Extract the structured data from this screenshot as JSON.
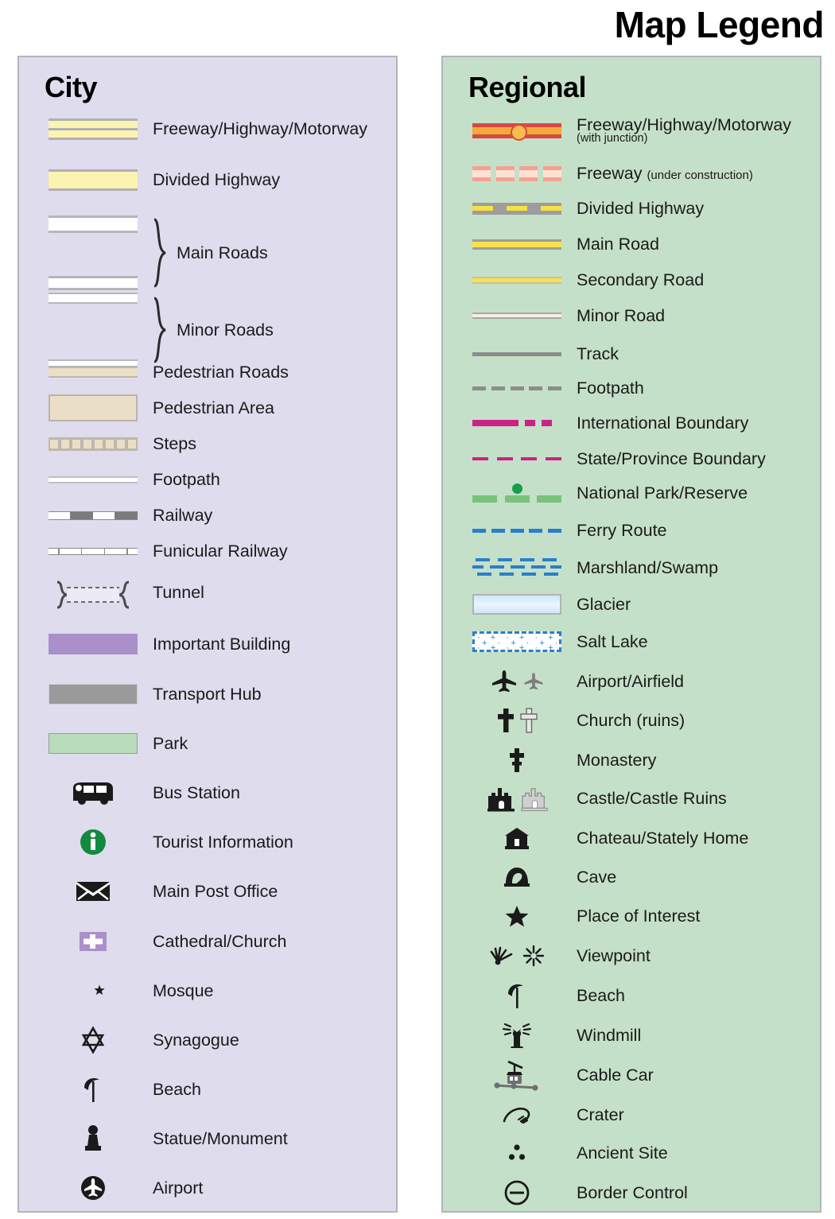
{
  "title": "Map Legend",
  "colors": {
    "city_panel_bg": "#dedced",
    "regional_panel_bg": "#c5e0c8",
    "panel_border": "#b4b4bc",
    "road_yellow": "#fbf3b0",
    "freeway_red": "#d9483f",
    "freeway_orange": "#f5a93c",
    "boundary_magenta": "#cc2288",
    "park_green": "#79c279",
    "ferry_blue": "#2a7fc9",
    "important_building_purple": "#ab8fc9",
    "transport_hub_grey": "#9a9a9a",
    "park_fill": "#b9dcbb",
    "pedestrian_tan": "#eadfc6",
    "tourist_info_green": "#138a3e"
  },
  "city": {
    "heading": "City",
    "items": [
      {
        "icon": "freeway-swatch",
        "label": "Freeway/Highway/Motorway"
      },
      {
        "icon": "divided-highway-swatch",
        "label": "Divided Highway"
      },
      {
        "icon": "main-roads-swatch",
        "label": "Main Roads"
      },
      {
        "icon": "minor-roads-swatch",
        "label": "Minor Roads"
      },
      {
        "icon": "pedestrian-roads-swatch",
        "label": "Pedestrian Roads"
      },
      {
        "icon": "pedestrian-area-swatch",
        "label": "Pedestrian Area"
      },
      {
        "icon": "steps-swatch",
        "label": "Steps"
      },
      {
        "icon": "footpath-swatch",
        "label": "Footpath"
      },
      {
        "icon": "railway-swatch",
        "label": "Railway"
      },
      {
        "icon": "funicular-railway-swatch",
        "label": "Funicular Railway"
      },
      {
        "icon": "tunnel-swatch",
        "label": "Tunnel"
      },
      {
        "icon": "important-building-swatch",
        "label": "Important Building"
      },
      {
        "icon": "transport-hub-swatch",
        "label": "Transport Hub"
      },
      {
        "icon": "park-swatch",
        "label": "Park"
      },
      {
        "icon": "bus-icon",
        "label": "Bus Station"
      },
      {
        "icon": "tourist-information-icon",
        "label": "Tourist Information"
      },
      {
        "icon": "envelope-icon",
        "label": "Main Post Office"
      },
      {
        "icon": "church-cross-icon",
        "label": "Cathedral/Church"
      },
      {
        "icon": "crescent-star-icon",
        "label": "Mosque"
      },
      {
        "icon": "star-of-david-icon",
        "label": "Synagogue"
      },
      {
        "icon": "beach-umbrella-icon",
        "label": "Beach"
      },
      {
        "icon": "statue-icon",
        "label": "Statue/Monument"
      },
      {
        "icon": "airport-circle-icon",
        "label": "Airport"
      }
    ]
  },
  "regional": {
    "heading": "Regional",
    "items": [
      {
        "icon": "freeway-junction-swatch",
        "label": "Freeway/Highway/Motorway",
        "sub": "(with junction)"
      },
      {
        "icon": "freeway-construction-swatch",
        "label": "Freeway",
        "inline_sub": "(under construction)"
      },
      {
        "icon": "divided-highway-swatch",
        "label": "Divided Highway"
      },
      {
        "icon": "main-road-swatch",
        "label": "Main Road"
      },
      {
        "icon": "secondary-road-swatch",
        "label": "Secondary Road"
      },
      {
        "icon": "minor-road-swatch",
        "label": "Minor Road"
      },
      {
        "icon": "track-swatch",
        "label": "Track"
      },
      {
        "icon": "footpath-swatch",
        "label": "Footpath"
      },
      {
        "icon": "international-boundary-swatch",
        "label": "International Boundary"
      },
      {
        "icon": "state-boundary-swatch",
        "label": "State/Province Boundary"
      },
      {
        "icon": "national-park-swatch",
        "label": "National Park/Reserve"
      },
      {
        "icon": "ferry-route-swatch",
        "label": "Ferry Route"
      },
      {
        "icon": "marshland-swatch",
        "label": "Marshland/Swamp"
      },
      {
        "icon": "glacier-swatch",
        "label": "Glacier"
      },
      {
        "icon": "salt-lake-swatch",
        "label": "Salt Lake"
      },
      {
        "icon": "airplane-icon",
        "label": "Airport/Airfield"
      },
      {
        "icon": "cross-icon",
        "label": "Church (ruins)"
      },
      {
        "icon": "monastery-cross-icon",
        "label": "Monastery"
      },
      {
        "icon": "castle-icon",
        "label": "Castle/Castle Ruins"
      },
      {
        "icon": "chateau-icon",
        "label": "Chateau/Stately Home"
      },
      {
        "icon": "cave-icon",
        "label": "Cave"
      },
      {
        "icon": "star-icon",
        "label": "Place of Interest"
      },
      {
        "icon": "viewpoint-icon",
        "label": "Viewpoint"
      },
      {
        "icon": "beach-umbrella-icon",
        "label": "Beach"
      },
      {
        "icon": "windmill-icon",
        "label": "Windmill"
      },
      {
        "icon": "cable-car-icon",
        "label": "Cable Car"
      },
      {
        "icon": "crater-icon",
        "label": "Crater"
      },
      {
        "icon": "ancient-site-icon",
        "label": "Ancient Site"
      },
      {
        "icon": "border-control-icon",
        "label": "Border Control"
      }
    ]
  }
}
